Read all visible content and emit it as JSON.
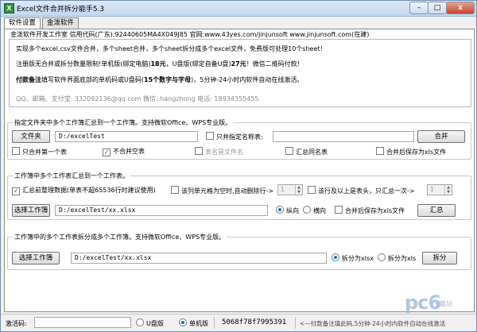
{
  "window": {
    "title": "Excel文件合并拆分能手5.3",
    "icon_label": "X",
    "min_label": "–",
    "max_label": "□",
    "close_label": "x"
  },
  "tabs": [
    {
      "label": "软件设置",
      "active": true
    },
    {
      "label": "金泼软件",
      "active": false
    }
  ],
  "info": {
    "header": "金泼软件开发工作室 信用代码(广东):92440605MA4X049J85  官网:www.43yes.com/jinjunsoft  www.jinjunsoft.com(在建)",
    "line1": "实现多个excel,csv文件合并，多个sheet合并，多个sheet拆分成多个excel文件，免费版可处理10个sheet！",
    "line2_a": "注册版无合并或拆分数量限制!单机版(绑定电脑)",
    "line2_b": "18元",
    "line2_c": "，U盘版(绑定自备U盘)",
    "line2_d": "27元",
    "line2_e": "！微信二维码付款！",
    "line3_a": "付款备注",
    "line3_b": "填写软件界面底部的单机码或U盘码(",
    "line3_c": "15个数字与字母",
    "line3_d": ")，5分钟-24小时内软件自动在线激活。",
    "contact": "QQ、邮箱、支付宝: 332092136@qq.com      微信: hangzhong      电话: 18934355455"
  },
  "group1": {
    "title": "指定文件夹中多个工作簿汇总到一个工作簿。支持微软Office、WPS专业版。",
    "folder_button": "文件夹",
    "folder_path": "D:/excelTest",
    "only_name_label": "只并指定名称表:",
    "only_name_value": "",
    "merge_button": "合并",
    "cb_first": "只合并第一个表",
    "cb_skip_empty": "不合并空表",
    "cb_sheet_filename": "表名是文件名",
    "cb_summary_sheet": "汇总同名表",
    "cb_save_xls": "合并后保存为xls文件"
  },
  "group2": {
    "title": "工作簿中多个工作表汇总到一个工作表。",
    "cb_tidy": "汇总前整理数据(单表不超65536行时建议使用)",
    "cb_empty_cell": "该列单元格为空时,自动删除行->",
    "empty_col_value": "1",
    "cb_header_rows": "该行及以上是表头，只汇总一次->",
    "header_rows_value": "1",
    "select_button": "选择工作簿",
    "file_path": "D:/excelTest/xx.xlsx",
    "radio_vertical": "纵向",
    "radio_horizontal": "横向",
    "cb_save_xls": "合并后保存为xls文件",
    "summary_button": "汇总"
  },
  "group3": {
    "title": "工作簿中的多个工作表拆分成多个工作簿。支持微软Office、WPS专业版。",
    "select_button": "选择工作簿",
    "file_path": "D:/excelTest/xx.xlsx",
    "radio_xlsx": "拆分为xlsx",
    "radio_xls": "拆分为xls",
    "split_button": "拆分"
  },
  "status": {
    "activation_label": "激活码:",
    "activation_value": "",
    "radio_usb": "U盘版",
    "radio_pc": "单机版",
    "machine_code": "5068f78f7995391",
    "hint": "<—付款备注填此码,5分钟-24小时内软件自动在线激活"
  },
  "watermark": {
    "logo": "pc6",
    "sub": "下载站"
  }
}
